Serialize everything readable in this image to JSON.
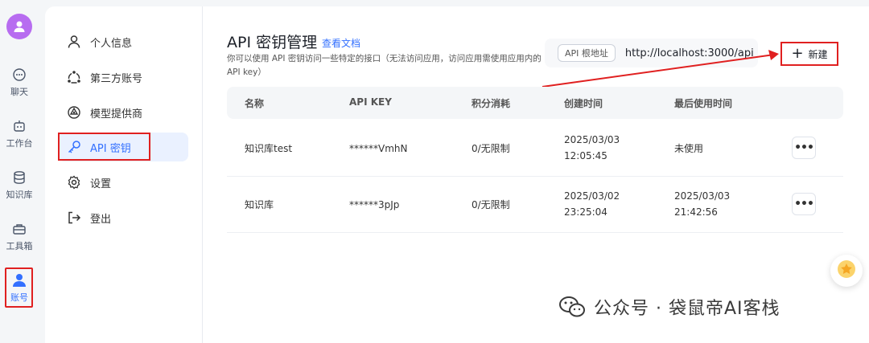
{
  "rail": {
    "items": [
      {
        "label": "聊天",
        "icon": "chat-icon"
      },
      {
        "label": "工作台",
        "icon": "robot-icon"
      },
      {
        "label": "知识库",
        "icon": "database-icon"
      },
      {
        "label": "工具箱",
        "icon": "toolbox-icon"
      },
      {
        "label": "账号",
        "icon": "user-icon",
        "active": true
      }
    ]
  },
  "menu": {
    "items": [
      {
        "label": "个人信息",
        "icon": "person-icon"
      },
      {
        "label": "第三方账号",
        "icon": "share-icon"
      },
      {
        "label": "模型提供商",
        "icon": "model-icon"
      },
      {
        "label": "API 密钥",
        "icon": "key-icon",
        "active": true
      },
      {
        "label": "设置",
        "icon": "gear-icon"
      },
      {
        "label": "登出",
        "icon": "logout-icon"
      }
    ]
  },
  "main": {
    "title": "API 密钥管理",
    "doc_link": "查看文档",
    "desc": "你可以使用 API 密钥访问一些特定的接口（无法访问应用，访问应用需使用应用内的 API key）",
    "base_url_tag": "API 根地址",
    "base_url": "http://localhost:3000/api",
    "new_button": "新建"
  },
  "table": {
    "headers": [
      "名称",
      "API KEY",
      "积分消耗",
      "创建时间",
      "最后使用时间"
    ],
    "rows": [
      {
        "name": "知识库test",
        "key": "******VmhN",
        "usage": "0/无限制",
        "created_date": "2025/03/03",
        "created_time": "12:05:45",
        "last_used_date": "未使用",
        "last_used_time": ""
      },
      {
        "name": "知识库",
        "key": "******3pJp",
        "usage": "0/无限制",
        "created_date": "2025/03/02",
        "created_time": "23:25:04",
        "last_used_date": "2025/03/03",
        "last_used_time": "21:42:56"
      }
    ],
    "more_label": "•••"
  },
  "watermark": "公众号 · 袋鼠帝AI客栈",
  "colors": {
    "accent": "#3370ff",
    "annotation": "#e02020",
    "avatar": "#b76cf0"
  }
}
